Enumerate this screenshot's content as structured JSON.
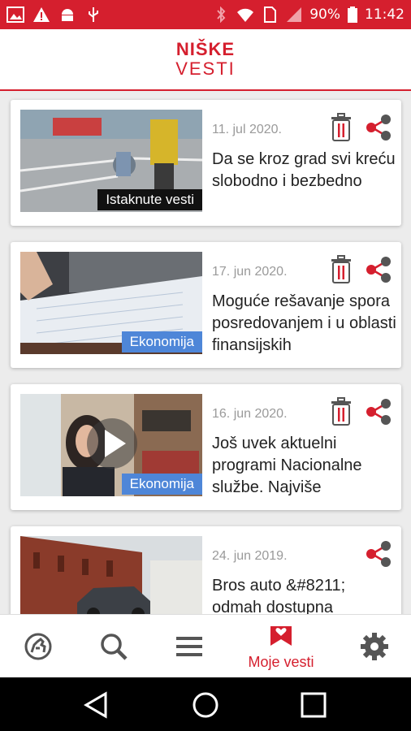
{
  "status_bar": {
    "battery": "90%",
    "time": "11:42",
    "background_color": "#d51f2e",
    "icons_left": [
      "image-icon",
      "warning-icon",
      "android-icon",
      "usb-icon"
    ],
    "icons_right": [
      "bluetooth-icon",
      "wifi-icon",
      "sim-icon",
      "signal-icon",
      "battery-icon"
    ]
  },
  "header": {
    "logo_line1": "NIŠKE",
    "logo_line2": "VESTI"
  },
  "articles": [
    {
      "date": "11. jul 2020.",
      "title": "Da se kroz grad svi kreću slobodno i bezbedno",
      "category": "Istaknute vesti",
      "category_style": "dark",
      "has_delete": true
    },
    {
      "date": "17. jun 2020.",
      "title": "Moguće rešavanje spora posredovanjem i u oblasti finansijskih",
      "category": "Ekonomija",
      "category_style": "blue",
      "has_delete": true
    },
    {
      "date": "16. jun 2020.",
      "title": "Još uvek aktuelni programi Nacionalne službe. Najviše",
      "category": "Ekonomija",
      "category_style": "blue",
      "has_delete": true,
      "has_video": true
    },
    {
      "date": "24. jun 2019.",
      "title": "Bros auto &#8211; odmah dostupna",
      "category": "",
      "category_style": "",
      "has_delete": false
    }
  ],
  "bottom_nav": {
    "items": [
      {
        "name": "home",
        "icon": "horseman-icon",
        "label": ""
      },
      {
        "name": "search",
        "icon": "search-icon",
        "label": ""
      },
      {
        "name": "menu",
        "icon": "menu-icon",
        "label": ""
      },
      {
        "name": "my-news",
        "icon": "bookmark-heart-icon",
        "label": "Moje vesti",
        "active": true
      },
      {
        "name": "settings",
        "icon": "gear-icon",
        "label": ""
      }
    ]
  },
  "colors": {
    "accent": "#d51f2e",
    "tag_blue": "#4e86d8",
    "icon_dark": "#555555"
  }
}
